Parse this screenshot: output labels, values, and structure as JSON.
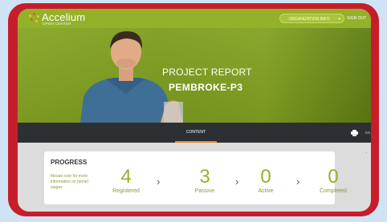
{
  "header": {
    "logo_name": "Accelium",
    "logo_sub": "OPEN CENTER",
    "org_button": "ORGANIZATION INFO",
    "sign_out": "SIGN OUT"
  },
  "hero": {
    "title": "PROJECT REPORT",
    "subtitle": "PEMBROKE-P3"
  },
  "navbar": {
    "tab": "CONTENT",
    "lang": "EN"
  },
  "progress": {
    "title": "PROGRESS",
    "hint": "Mouse over for more information on funnel stages",
    "stages": [
      {
        "value": "4",
        "label": "Registered"
      },
      {
        "value": "3",
        "label": "Passive"
      },
      {
        "value": "0",
        "label": "Active"
      },
      {
        "value": "0",
        "label": "Completed"
      }
    ]
  },
  "colors": {
    "brand_green": "#93b22a",
    "frame_red": "#c71d2a",
    "accent_orange": "#e8862a"
  }
}
